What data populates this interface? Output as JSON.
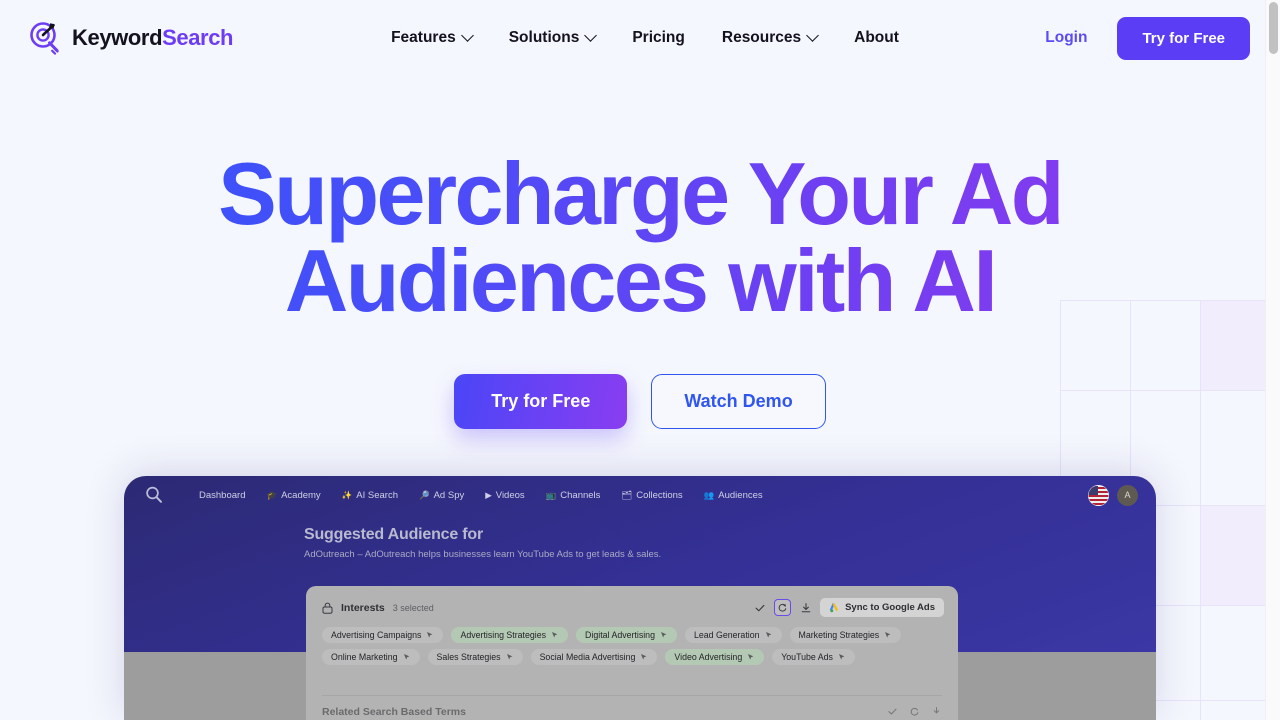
{
  "brand": {
    "name_part1": "Keyword",
    "name_part2": "Search",
    "logo_icon": "target-magnifier-icon"
  },
  "nav": {
    "items": [
      {
        "label": "Features",
        "has_dropdown": true
      },
      {
        "label": "Solutions",
        "has_dropdown": true
      },
      {
        "label": "Pricing",
        "has_dropdown": false
      },
      {
        "label": "Resources",
        "has_dropdown": true
      },
      {
        "label": "About",
        "has_dropdown": false
      }
    ],
    "login_label": "Login",
    "cta_label": "Try for Free"
  },
  "hero": {
    "title_line1": "Supercharge Your Ad",
    "title_line2": "Audiences with AI",
    "primary_cta": "Try for Free",
    "secondary_cta": "Watch Demo",
    "gradient_start": "#3355fb",
    "gradient_end": "#9338ec"
  },
  "app_mockup": {
    "search_icon": "search-icon",
    "nav_items": [
      {
        "label": "Dashboard",
        "icon": ""
      },
      {
        "label": "Academy",
        "icon": "🎓"
      },
      {
        "label": "AI Search",
        "icon": "✨"
      },
      {
        "label": "Ad Spy",
        "icon": "🔎"
      },
      {
        "label": "Videos",
        "icon": "▶"
      },
      {
        "label": "Channels",
        "icon": "📺"
      },
      {
        "label": "Collections",
        "icon": "🗂"
      },
      {
        "label": "Audiences",
        "icon": "👥"
      }
    ],
    "flag_icon": "us-flag-icon",
    "avatar_initial": "A",
    "heading": "Suggested Audience for",
    "subheading": "AdOutreach – AdOutreach helps businesses learn YouTube Ads to get leads & sales.",
    "panel": {
      "title": "Interests",
      "count_label": "3 selected",
      "lock_icon": "lock-icon",
      "tools": [
        {
          "name": "check-icon",
          "glyph": "✓",
          "boxed": false
        },
        {
          "name": "refresh-icon",
          "glyph": "♻",
          "boxed": true
        },
        {
          "name": "download-icon",
          "glyph": "↧",
          "boxed": false
        }
      ],
      "sync_label": "Sync to Google Ads",
      "sync_icon": "google-ads-icon",
      "chips": [
        {
          "label": "Advertising Campaigns",
          "selected": false
        },
        {
          "label": "Advertising Strategies",
          "selected": true
        },
        {
          "label": "Digital Advertising",
          "selected": true
        },
        {
          "label": "Lead Generation",
          "selected": false
        },
        {
          "label": "Marketing Strategies",
          "selected": false
        },
        {
          "label": "Online Marketing",
          "selected": false
        },
        {
          "label": "Sales Strategies",
          "selected": false
        },
        {
          "label": "Social Media Advertising",
          "selected": false
        },
        {
          "label": "Video Advertising",
          "selected": true
        },
        {
          "label": "YouTube Ads",
          "selected": false
        }
      ],
      "next_section_title": "Related Search Based Terms"
    }
  }
}
